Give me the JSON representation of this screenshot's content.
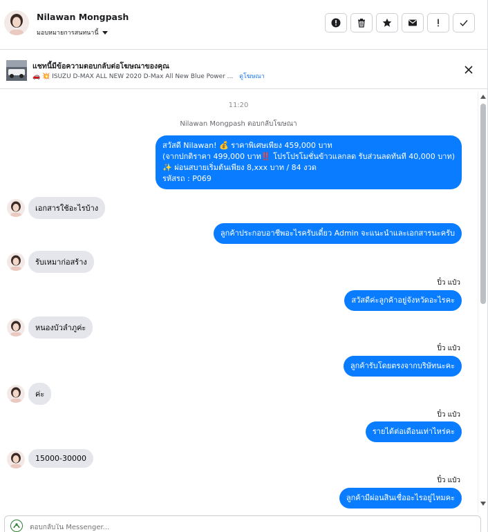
{
  "header": {
    "contact_name": "Nilawan Mongpash",
    "assign_label": "มอบหมายการสนทนานี้",
    "actions": [
      "report-icon",
      "trash-icon",
      "star-icon",
      "envelope-icon",
      "exclamation-icon",
      "check-icon"
    ]
  },
  "ad_banner": {
    "title": "แชทนี้มีข้อความตอบกลับต่อโฆษณาของคุณ",
    "subtitle": "🚗 💥 ISUZU D-MAX ALL NEW 2020 D-Max All New Blue Power ...",
    "link_label": "ดูโฆษณา"
  },
  "thread": {
    "timestamp": "11:20",
    "reply_note": "Nilawan Mongpash ตอบกลับโฆษณา",
    "messages": [
      {
        "dir": "out",
        "lines": [
          "สวัสดี Nilawan! 💰 ราคาพิเศษเพียง 459,000 บาท",
          "(จากปกติราคา 499,000 บาท‼️ โปรโปรโมชั่นข้าวแลกลด รับส่วนลดทันที 40,000 บาท)",
          "✨ ผ่อนสบายเริ่มต้นเพียง 8,xxx บาท / 84 งวด",
          " รหัสรถ : P069"
        ]
      },
      {
        "dir": "in",
        "text": "เอกสารใช้อะไรบ้าง"
      },
      {
        "dir": "out",
        "text": "ลูกค้าประกอบอาชีพอะไรครับเดี๋ยว Admin จะแนะนำและเอกสารนะครับ"
      },
      {
        "dir": "in",
        "text": "รับเหมาก่อสร้าง"
      },
      {
        "dir": "out",
        "sender": "ปิ๋ว แป๋ว",
        "text": "สวัสดีค่ะลูกค้าอยู่จังหวัดอะไรคะ"
      },
      {
        "dir": "in",
        "text": "หนองบัวลำภูค่ะ"
      },
      {
        "dir": "out",
        "sender": "ปิ๋ว แป๋ว",
        "text": "ลูกค้ารับโดยตรงจากบริษัทนะคะ"
      },
      {
        "dir": "in",
        "text": "ค่ะ"
      },
      {
        "dir": "out",
        "sender": "ปิ๋ว แป๋ว",
        "text": "รายได้ต่อเดือนเท่าไหร่คะ"
      },
      {
        "dir": "in",
        "text": "15000-30000"
      },
      {
        "dir": "out",
        "sender": "ปิ๋ว แป๋ว",
        "text": "ลูกค้ามีผ่อนสินเชื่ออะไรอยู่ไหมคะ"
      }
    ]
  },
  "composer": {
    "placeholder": "ตอบกลับใน Messenger..."
  },
  "colors": {
    "outgoing_bubble": "#0a7cff",
    "incoming_bubble": "#e4e6eb",
    "link": "#1877f2"
  }
}
